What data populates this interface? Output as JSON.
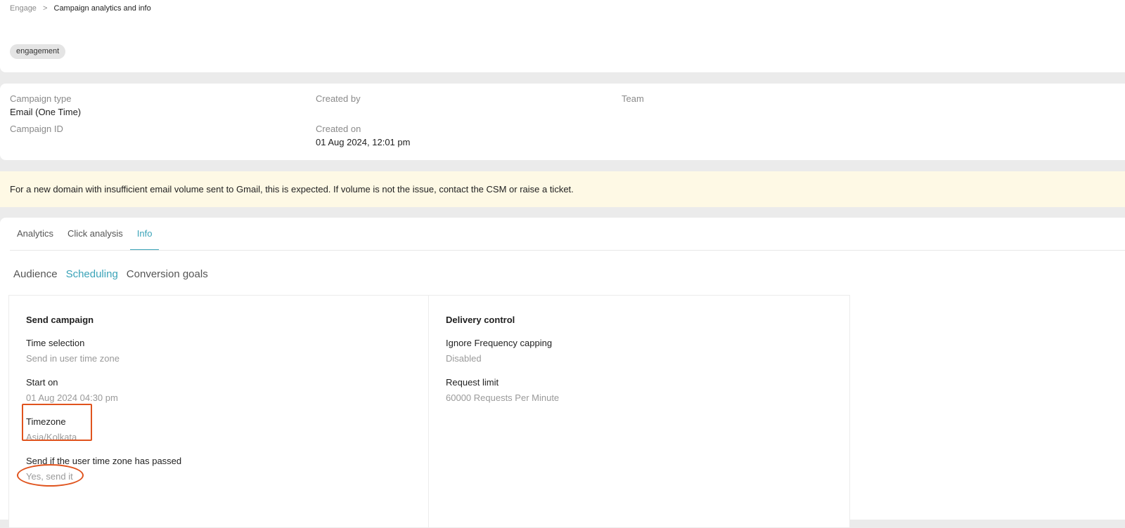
{
  "breadcrumb": {
    "parent": "Engage",
    "separator": ">",
    "current": "Campaign analytics and info"
  },
  "tag": "engagement",
  "meta": {
    "campaign_type": {
      "label": "Campaign type",
      "value": "Email (One Time)"
    },
    "campaign_id": {
      "label": "Campaign ID",
      "value": ""
    },
    "created_by": {
      "label": "Created by",
      "value": ""
    },
    "created_on": {
      "label": "Created on",
      "value": "01 Aug 2024, 12:01 pm"
    },
    "team": {
      "label": "Team",
      "value": ""
    }
  },
  "notice": "For a new domain with insufficient email volume sent to Gmail, this is expected. If volume is not the issue, contact the CSM or raise a ticket.",
  "tabs_primary": [
    "Analytics",
    "Click analysis",
    "Info"
  ],
  "tabs_primary_active": "Info",
  "tabs_secondary": [
    "Audience",
    "Scheduling",
    "Conversion goals"
  ],
  "tabs_secondary_active": "Scheduling",
  "send_campaign": {
    "title": "Send campaign",
    "time_selection": {
      "label": "Time selection",
      "value": "Send in user time zone"
    },
    "start_on": {
      "label": "Start on",
      "value": "01 Aug 2024 04:30 pm"
    },
    "timezone": {
      "label": "Timezone",
      "value": "Asia/Kolkata"
    },
    "send_if_passed": {
      "label": "Send if the user time zone has passed",
      "value": "Yes, send it"
    }
  },
  "delivery_control": {
    "title": "Delivery control",
    "ignore_frequency_capping": {
      "label": "Ignore Frequency capping",
      "value": "Disabled"
    },
    "request_limit": {
      "label": "Request limit",
      "value": "60000 Requests Per Minute"
    }
  },
  "annotation_color": "#e0531d",
  "accent_color": "#3aa3b8"
}
